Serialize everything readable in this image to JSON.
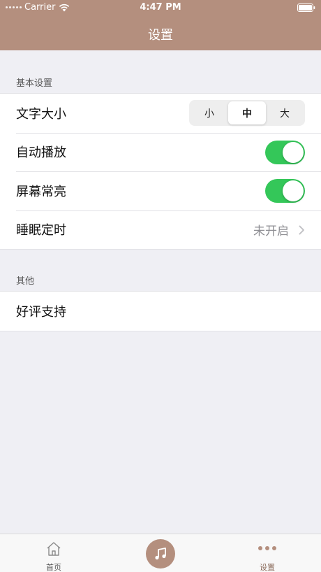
{
  "status_bar": {
    "carrier": "Carrier",
    "time": "4:47 PM"
  },
  "header": {
    "title": "设置"
  },
  "sections": {
    "basic": {
      "label": "基本设置",
      "font_size": {
        "label": "文字大小",
        "options": [
          "小",
          "中",
          "大"
        ],
        "selected": "中"
      },
      "autoplay": {
        "label": "自动播放",
        "on": true
      },
      "screen_on": {
        "label": "屏幕常亮",
        "on": true
      },
      "sleep_timer": {
        "label": "睡眠定时",
        "value": "未开启"
      }
    },
    "other": {
      "label": "其他",
      "rate": {
        "label": "好评支持"
      }
    }
  },
  "tabbar": {
    "home": {
      "label": "首页",
      "icon": "home-icon"
    },
    "play": {
      "icon": "music-note-icon"
    },
    "settings": {
      "label": "设置",
      "icon": "more-dots-icon"
    }
  },
  "colors": {
    "brand": "#b48f7e",
    "toggle_on": "#34c759",
    "background": "#efeff4"
  }
}
